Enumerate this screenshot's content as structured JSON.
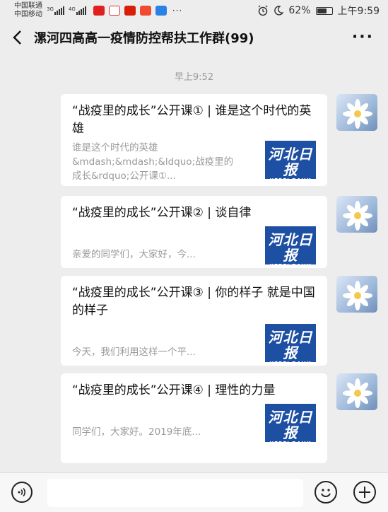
{
  "status_bar": {
    "carrier_1": "中国联通",
    "carrier_2": "中国移动",
    "network_1": "3G",
    "network_2": "4G",
    "battery": "62%",
    "time": "上午9:59",
    "more": "···"
  },
  "header": {
    "title": "漯河四高高一疫情防控帮扶工作群(99)",
    "menu": "···"
  },
  "timestamp": "早上9:52",
  "messages": [
    {
      "title": "“战疫里的成长”公开课① | 谁是这个时代的英雄",
      "description": "谁是这个时代的英雄&mdash;&mdash;&ldquo;战疫里的成长&rdquo;公开课①...",
      "thumb_logo": "河北日报",
      "thumb_sub": "HEBEI DAILY"
    },
    {
      "title": "“战疫里的成长”公开课② | 谈自律",
      "description": "亲爱的同学们，大家好，今...",
      "thumb_logo": "河北日报",
      "thumb_sub": "HEBEI DAILY"
    },
    {
      "title": "“战疫里的成长”公开课③ | 你的样子 就是中国的样子",
      "description": "今天，我们利用这样一个平...",
      "thumb_logo": "河北日报",
      "thumb_sub": "HEBEI DAILY"
    },
    {
      "title": "“战疫里的成长”公开课④ | 理性的力量",
      "description": "同学们，大家好。2019年底...",
      "thumb_logo": "河北日报",
      "thumb_sub": "HEBEI DAILY"
    }
  ],
  "input_bar": {
    "value": "",
    "placeholder": ""
  },
  "colors": {
    "background": "#ededed",
    "card": "#ffffff",
    "thumb_blue": "#1d4fa3",
    "muted_text": "#9a9a9a"
  }
}
